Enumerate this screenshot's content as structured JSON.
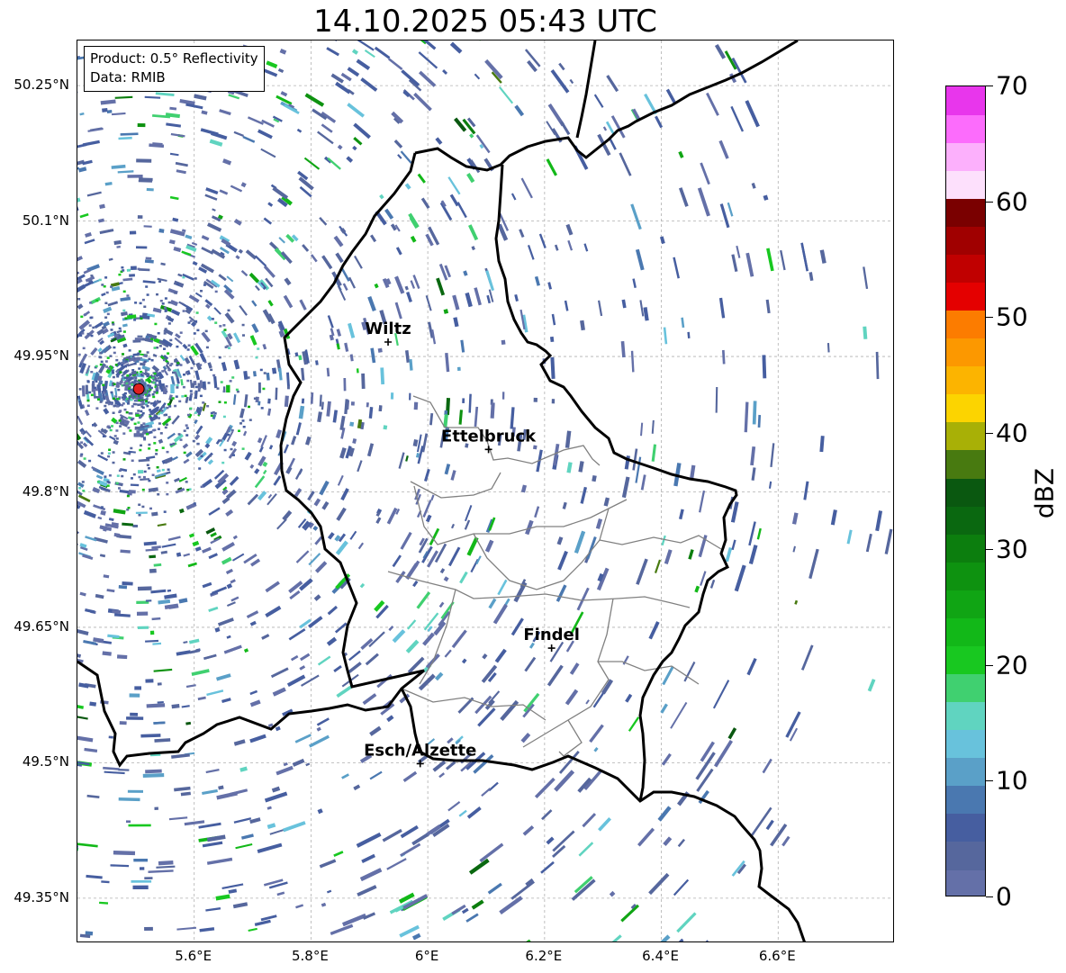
{
  "title": "14.10.2025 05:43 UTC",
  "info": {
    "product": "Product: 0.5° Reflectivity",
    "data": "Data: RMIB"
  },
  "map": {
    "lat_range": [
      49.3,
      50.3
    ],
    "lon_range": [
      5.4,
      6.8
    ],
    "lat_ticks": [
      "50.25°N",
      "50.1°N",
      "49.95°N",
      "49.8°N",
      "49.65°N",
      "49.5°N",
      "49.35°N"
    ],
    "lon_ticks": [
      "5.6°E",
      "5.8°E",
      "6°E",
      "6.2°E",
      "6.4°E",
      "6.6°E"
    ],
    "radar_site": {
      "lat": 49.914,
      "lon": 5.505
    },
    "cities": [
      {
        "name": "Wiltz",
        "lat": 49.966,
        "lon": 5.932
      },
      {
        "name": "Ettelbruck",
        "lat": 49.847,
        "lon": 6.104
      },
      {
        "name": "Findel",
        "lat": 49.627,
        "lon": 6.212
      },
      {
        "name": "Esch/Alzette",
        "lat": 49.499,
        "lon": 5.987
      }
    ],
    "border_color": "#000000",
    "canton_color": "#808080",
    "grid": true
  },
  "colorbar": {
    "label": "dBZ",
    "min": 0,
    "max": 70,
    "tick_labels": [
      "70",
      "60",
      "50",
      "40",
      "30",
      "20",
      "10",
      "0"
    ],
    "tick_values": [
      70,
      60,
      50,
      40,
      30,
      20,
      10,
      0
    ],
    "colors": [
      "#6470a8",
      "#56679d",
      "#465ea0",
      "#4a78b0",
      "#5aa0c8",
      "#68c2dc",
      "#60d4c0",
      "#40d070",
      "#18c820",
      "#12b818",
      "#10a514",
      "#0e9210",
      "#0c7e0e",
      "#0a6810",
      "#0a5810",
      "#487a10",
      "#a8b006",
      "#fcd400",
      "#fcb400",
      "#fc9800",
      "#fc7c00",
      "#e40000",
      "#c00000",
      "#a00000",
      "#7a0000",
      "#fde0fc",
      "#fcb0fc",
      "#fc6cfc",
      "#e836ec"
    ]
  }
}
